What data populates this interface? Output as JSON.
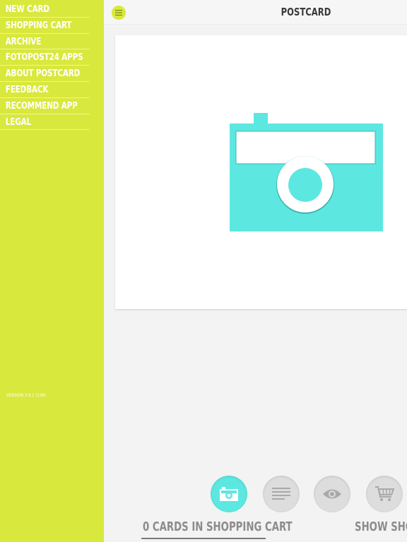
{
  "sidebar": {
    "items": [
      {
        "label": "New Card"
      },
      {
        "label": "Shopping Cart"
      },
      {
        "label": "Archive"
      },
      {
        "label": "Fotopost24 Apps"
      },
      {
        "label": "About Postcard"
      },
      {
        "label": "Feedback"
      },
      {
        "label": "Recommend App"
      },
      {
        "label": "Legal"
      }
    ],
    "version": "Version 3.9.1 (139)"
  },
  "header": {
    "title": "POSTCARD",
    "menu_icon": "menu-icon"
  },
  "card": {
    "icon": "camera-icon"
  },
  "toolbar": {
    "buttons": [
      {
        "icon": "camera-icon",
        "active": true
      },
      {
        "icon": "text-lines-icon",
        "active": false
      },
      {
        "icon": "eye-icon",
        "active": false
      },
      {
        "icon": "shopping-cart-icon",
        "active": false
      }
    ]
  },
  "status": {
    "cart_count": "0 cards in shopping cart",
    "show_shop": "Show Shop"
  },
  "colors": {
    "accent": "#d9e83c",
    "camera": "#5de7e1"
  }
}
